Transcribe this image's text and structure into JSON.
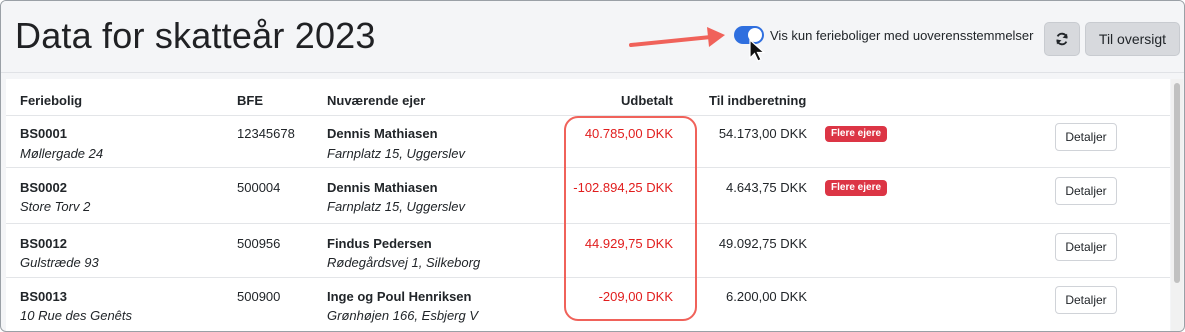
{
  "header": {
    "title": "Data for skatteår 2023",
    "toggle_label": "Vis kun ferieboliger med uoverensstemmelser",
    "toggle_on": true,
    "refresh_icon": "refresh-icon",
    "overview_label": "Til oversigt"
  },
  "table": {
    "columns": [
      "Feriebolig",
      "BFE",
      "Nuværende ejer",
      "Udbetalt",
      "Til indberetning"
    ],
    "rows": [
      {
        "id": "BS0001",
        "address": "Møllergade 24",
        "bfe": "12345678",
        "owner": "Dennis Mathiasen",
        "owner_address": "Farnplatz 15, Uggerslev",
        "paid": "40.785,00 DKK",
        "report": "54.173,00 DKK",
        "badge": "Flere ejere",
        "details": "Detaljer"
      },
      {
        "id": "BS0002",
        "address": "Store Torv 2",
        "bfe": "500004",
        "owner": "Dennis Mathiasen",
        "owner_address": "Farnplatz 15, Uggerslev",
        "paid": "-102.894,25 DKK",
        "report": "4.643,75 DKK",
        "badge": "Flere ejere",
        "details": "Detaljer"
      },
      {
        "id": "BS0012",
        "address": "Gulstræde 93",
        "bfe": "500956",
        "owner": "Findus Pedersen",
        "owner_address": "Rødegårdsvej 1, Silkeborg",
        "paid": "44.929,75 DKK",
        "report": "49.092,75 DKK",
        "badge": "",
        "details": "Detaljer"
      },
      {
        "id": "BS0013",
        "address": "10 Rue des Genêts",
        "bfe": "500900",
        "owner": "Inge og Poul Henriksen",
        "owner_address": "Grønhøjen 166, Esbjerg V",
        "paid": "-209,00 DKK",
        "report": "6.200,00 DKK",
        "badge": "",
        "details": "Detaljer"
      }
    ]
  },
  "colors": {
    "accent": "#2f6fdf",
    "paid_text": "#e11d1d",
    "badge": "#dc3545",
    "annotation": "#f0625a"
  }
}
